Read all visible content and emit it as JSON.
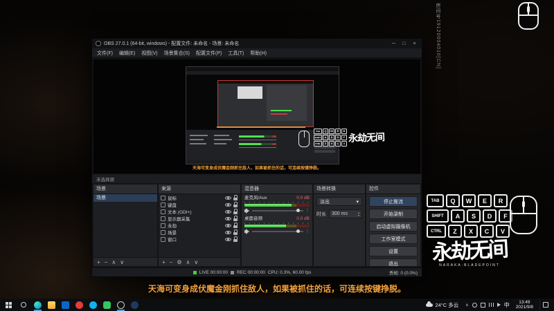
{
  "obs": {
    "window_title": "OBS 27.0.1 (64-bit, windows) - 配置文件: 未命名 - 场景: 未命名",
    "menu": [
      "文件(F)",
      "编辑(E)",
      "视图(V)",
      "场景集合(S)",
      "配置文件(P)",
      "工具(T)",
      "帮助(H)"
    ],
    "source_toolbar_hint": "未选择源",
    "scenes": {
      "title": "场景",
      "items": [
        "场景"
      ]
    },
    "sources": {
      "title": "来源",
      "items": [
        "鼠标",
        "键盘",
        "文本 (GDI+)",
        "显示器采集",
        "永劫",
        "场景",
        "窗口"
      ]
    },
    "mixer": {
      "title": "混音器",
      "channels": [
        {
          "name": "麦克风/Aux",
          "db": "0.0 dB",
          "level_percent": 72
        },
        {
          "name": "桌面音频",
          "db": "0.0 dB",
          "level_percent": 64
        }
      ]
    },
    "transitions": {
      "title": "场景转换",
      "selected": "淡出",
      "duration_label": "时长",
      "duration_value": "300 ms"
    },
    "controls": {
      "title": "控件",
      "buttons": [
        "停止推流",
        "开始录制",
        "启动虚拟摄像机",
        "工作室模式",
        "设置",
        "退出"
      ]
    },
    "statusbar": {
      "live": "LIVE 00:00:00",
      "rec": "REC 00:00:00",
      "cpu": "CPU: 0.3%, 60.00 fps",
      "dropped": "丢帧: 0 (0.0%)"
    }
  },
  "overlay": {
    "room_id": "房间号19120004016[CN]",
    "keyboard": {
      "rows": [
        [
          "TAB",
          "Q",
          "W",
          "E",
          "R"
        ],
        [
          "SHIFT",
          "A",
          "S",
          "D",
          "F"
        ],
        [
          "CTRL",
          "Z",
          "X",
          "C",
          "V"
        ]
      ]
    },
    "logo": {
      "text": "永劫无间",
      "subtext": "NARAKA:BLADEPOINT"
    },
    "marquee": "天海可变身成伏魔金刚抓住敌人，如果被抓住的话，可连续按键挣脱。"
  },
  "taskbar": {
    "weather": "24°C 多云",
    "ime": "中",
    "time": "13:49",
    "date": "2021/9/8",
    "app_icons": [
      "edge",
      "explorer",
      "store",
      "music",
      "qq",
      "wechat",
      "obs",
      "steam"
    ]
  },
  "glyphs": {
    "minimize": "─",
    "maximize": "□",
    "close": "×",
    "plus": "+",
    "minus": "−",
    "up": "∧",
    "down": "∨",
    "gear": "⚙",
    "chevron_down": "▾",
    "spin_up": "▴",
    "spin_down": "▾",
    "dots": "⋮",
    "tray_chevron": "∧"
  },
  "colors": {
    "accent_live_green": "#3fd23f",
    "meter_green": "#52e052",
    "db_red": "#e06a6a",
    "marquee_orange": "#f4a23c",
    "selection_red": "#cf3434"
  }
}
